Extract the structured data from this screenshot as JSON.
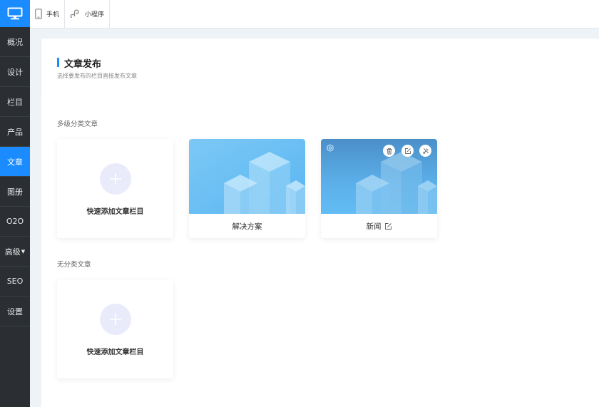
{
  "topbar": {
    "mobile_label": "手机",
    "miniapp_label": "小程序"
  },
  "sidebar": {
    "items": [
      {
        "label": "概况"
      },
      {
        "label": "设计"
      },
      {
        "label": "栏目"
      },
      {
        "label": "产品"
      },
      {
        "label": "文章",
        "active": true
      },
      {
        "label": "图册"
      },
      {
        "label": "O2O"
      },
      {
        "label": "高级"
      },
      {
        "label": "SEO"
      },
      {
        "label": "设置"
      }
    ]
  },
  "header": {
    "title": "文章发布",
    "subtitle": "选择要发布的栏目直接发布文章"
  },
  "sections": {
    "multi_label": "多级分类文章",
    "none_label": "无分类文章"
  },
  "cards": {
    "add_label": "快速添加文章栏目",
    "items": [
      {
        "label": "解决方案"
      },
      {
        "label": "新闻"
      }
    ]
  },
  "colors": {
    "accent": "#1a8cff",
    "sidebar_bg": "#2b2f33"
  }
}
